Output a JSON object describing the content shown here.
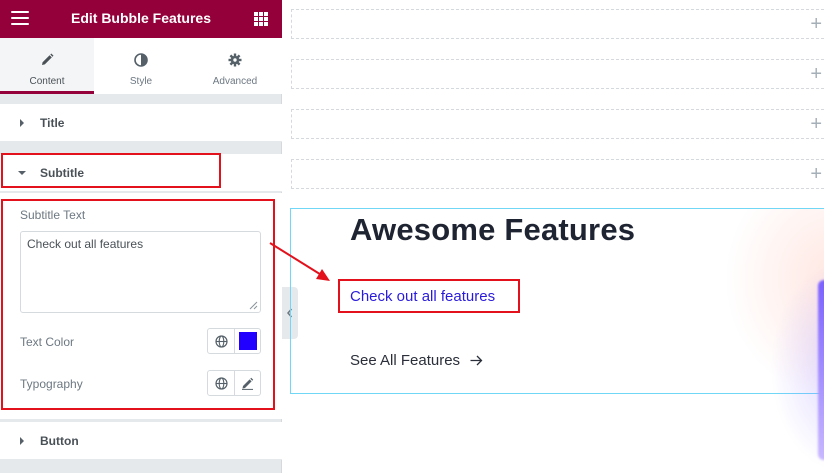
{
  "header": {
    "title": "Edit Bubble Features"
  },
  "tabs": [
    {
      "label": "Content",
      "icon": "pencil-icon",
      "active": true
    },
    {
      "label": "Style",
      "icon": "contrast-icon",
      "active": false
    },
    {
      "label": "Advanced",
      "icon": "gear-icon",
      "active": false
    }
  ],
  "sections": {
    "title": "Title",
    "subtitle": "Subtitle",
    "button": "Button"
  },
  "subtitle_panel": {
    "subtitle_text_label": "Subtitle Text",
    "subtitle_text_value": "Check out all features",
    "text_color_label": "Text Color",
    "text_color_value": "#2200ff",
    "typography_label": "Typography"
  },
  "preview": {
    "heading": "Awesome Features",
    "subheading": "Check out all features",
    "subheading_color": "#2a1bdc",
    "link_label": "See All Features"
  },
  "colors": {
    "brand": "#93003a",
    "annotation": "#e3111b",
    "selection_outline": "#71d7f7"
  }
}
